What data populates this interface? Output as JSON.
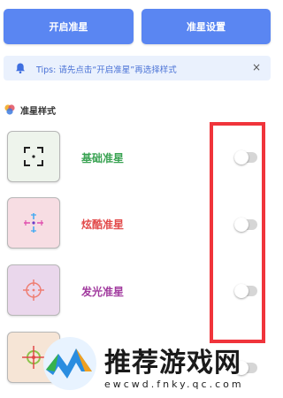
{
  "buttons": {
    "start": "开启准星",
    "settings": "准星设置"
  },
  "tip": {
    "text": "Tips: 请先点击“开启准星”再选择样式",
    "close": "×"
  },
  "section": {
    "title": "准星样式"
  },
  "styles": [
    {
      "label": "基础准星",
      "color": "#3aa353",
      "bg": "#eef4ec",
      "enabled": false
    },
    {
      "label": "炫酷准星",
      "color": "#e24a4a",
      "bg": "#f7dde3",
      "enabled": false
    },
    {
      "label": "发光准星",
      "color": "#a13a9e",
      "bg": "#ead7ec",
      "enabled": false
    },
    {
      "label": "",
      "color": "#d84a3a",
      "bg": "#f6e5d6",
      "enabled": false
    }
  ],
  "colors": {
    "primary": "#5a86f2",
    "tip_bg": "#eaf1fd",
    "highlight": "#f0343b"
  },
  "watermark": {
    "name": "推荐游戏网",
    "url": "ewcwd.fnky.qc.com"
  }
}
